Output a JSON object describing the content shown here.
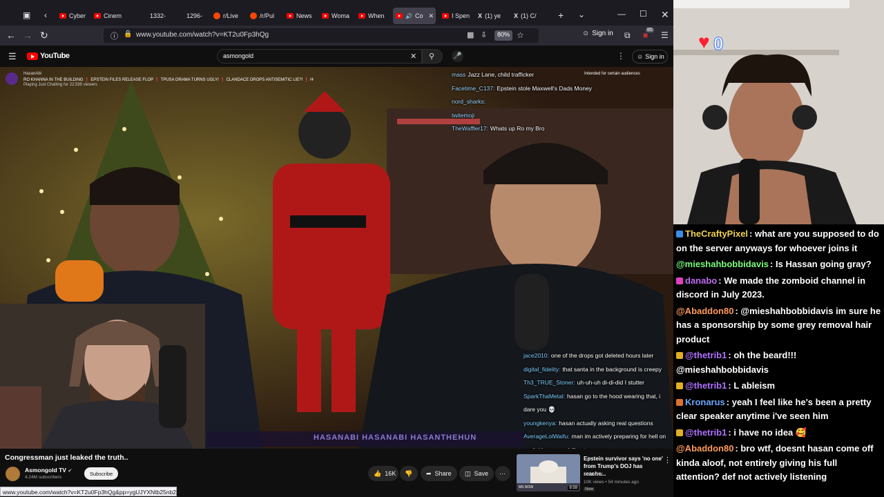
{
  "browser": {
    "tabs": [
      {
        "label": "Cyber",
        "icon": "youtube"
      },
      {
        "label": "Cinem",
        "icon": "youtube"
      },
      {
        "label": "1332-",
        "icon": "none"
      },
      {
        "label": "1296-",
        "icon": "none"
      },
      {
        "label": "r/Live",
        "icon": "reddit"
      },
      {
        "label": "/r/Pul",
        "icon": "reddit"
      },
      {
        "label": "News",
        "icon": "youtube"
      },
      {
        "label": "Woma",
        "icon": "youtube"
      },
      {
        "label": "When",
        "icon": "youtube"
      },
      {
        "label": "Co",
        "icon": "youtube"
      },
      {
        "label": "I Spen",
        "icon": "youtube"
      },
      {
        "label": "(1) ye",
        "icon": "x"
      },
      {
        "label": "(1) C/",
        "icon": "x"
      }
    ],
    "url": "www.youtube.com/watch?v=KT2u0Fp3hQg",
    "zoom": "80%",
    "sign_in": "Sign in",
    "ext_badge": "85"
  },
  "youtube": {
    "logo": "YouTube",
    "search_value": "asmongold",
    "sign_in": "Sign in"
  },
  "video": {
    "top_channel": "HasanAbi",
    "top_title": "RO KHANNA IN THE BUILDING ❗ EPSTEIN FILES RELEASE FLOP ❗ TPUSA DRAMA TURNS UGLY! ❗ CLANDACE DROPS ANTISEMITIC LIE?! ❗ HOOWATCH",
    "top_sub": "Playing Just Chatting for 22,595 viewers",
    "audience_note": "Intended for certain audiences",
    "overlay_top": [
      {
        "name": "mass",
        "text": "Jazz Lane, child trafficker"
      },
      {
        "name": "Facetime_C137:",
        "text": "Epstein stole Maxwell's Dads Money"
      },
      {
        "name": "nord_sharks:",
        "text": ""
      },
      {
        "name": "twitemoji",
        "text": ""
      },
      {
        "name": "TheWaffler17:",
        "text": "Whats up Ro my Bro"
      }
    ],
    "overlay_bottom": [
      {
        "name": "jace2010:",
        "text": "one of the drops got deleted hours later"
      },
      {
        "name": "digital_fidelity:",
        "text": "that santa in the background is creepy"
      },
      {
        "name": "Th3_TRUE_Stoner:",
        "text": "uh-uh-uh di-di-did I stutter"
      },
      {
        "name": "SparkThaMetal:",
        "text": "hasan go to the hood wearing that, i"
      },
      {
        "name": "",
        "text": "dare you 💀"
      },
      {
        "name": "youngkenya:",
        "text": "hasan actually asking real questions"
      },
      {
        "name": "AverageLolWaifu:",
        "text": "man im actively preparing for hell on"
      },
      {
        "name": "",
        "text": "earth i hope we chill out cmon"
      }
    ],
    "banner": "HASANABI  HASANABI  HASANTHEHUN"
  },
  "below": {
    "title": "Congressman just leaked the truth..",
    "channel": "Asmongold TV",
    "subscribers": "4.24M subscribers",
    "subscribe": "Subscribe",
    "likes": "16K",
    "share": "Share",
    "save": "Save"
  },
  "recommended": {
    "title_line1": "Epstein survivor says 'no one'",
    "title_line2": "from Trump's DOJ has reache...",
    "channel": "MS NOW",
    "meta": "10K views • 54 minutes ago",
    "badge": "New",
    "duration": "9:59",
    "thumb_label": "MS NOW"
  },
  "status_url": "www.youtube.com/watch?v=KT2u0Fp3hQg&pp=ygUJYXNtb25nb2xk",
  "cam_overlay": "0",
  "chat": [
    {
      "user": "TheCraftyPixel",
      "color": "#f0d050",
      "text": "what are you supposed to do on the server anyways for whoever joins it",
      "badge": "#3a8ee6"
    },
    {
      "user": "@mieshahbobbidavis",
      "color": "#7cfc7c",
      "text": "Is Hassan going gray?",
      "badge": ""
    },
    {
      "user": "danabo",
      "color": "#c06cf0",
      "text": "We made the zomboid channel in discord in July 2023.",
      "badge": "#e040c0"
    },
    {
      "user": "@Abaddon80",
      "color": "#ff9a5a",
      "text": "@mieshahbobbidavis im sure he has a sponsorship by some grey removal hair product",
      "badge": ""
    },
    {
      "user": "@thetrib1",
      "color": "#b070ff",
      "text": "oh the beard!!! @mieshahbobbidavis",
      "badge": "#e0b020"
    },
    {
      "user": "@thetrib1",
      "color": "#b070ff",
      "text": "L ableism",
      "badge": "#e0b020"
    },
    {
      "user": "Kronarus",
      "color": "#6aa8ff",
      "text": "yeah I feel like he's been a pretty clear speaker anytime i've seen him",
      "badge": "#e07030"
    },
    {
      "user": "@thetrib1",
      "color": "#b070ff",
      "text": "i have no idea 🥰",
      "badge": "#e0b020"
    },
    {
      "user": "@Abaddon80",
      "color": "#ff9a5a",
      "text": "bro wtf, doesnt hasan come off kinda aloof, not entirely giving his full attention? def not actively listening",
      "badge": ""
    }
  ]
}
